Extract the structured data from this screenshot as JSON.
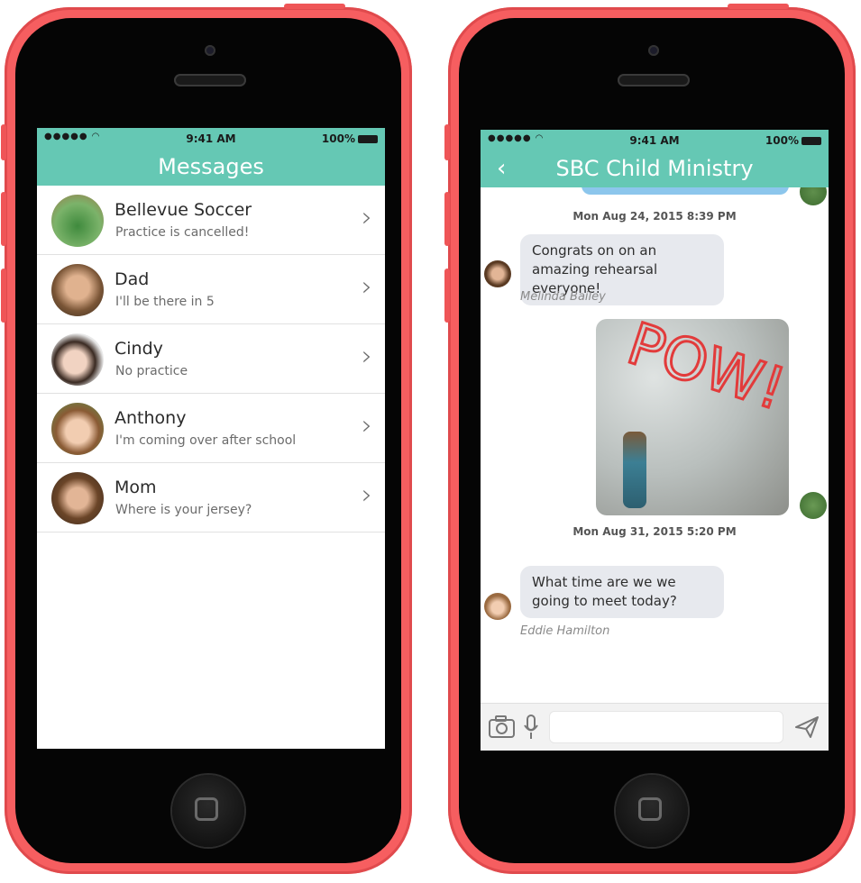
{
  "status_bar": {
    "signal": "●●●●● ",
    "time": "9:41 AM",
    "battery": "100%"
  },
  "left_screen": {
    "title": "Messages",
    "conversations": [
      {
        "name": "Bellevue Soccer",
        "preview": "Practice is cancelled!"
      },
      {
        "name": "Dad",
        "preview": "I'll be there in 5"
      },
      {
        "name": "Cindy",
        "preview": "No practice"
      },
      {
        "name": "Anthony",
        "preview": "I'm coming over after school"
      },
      {
        "name": "Mom",
        "preview": "Where is your jersey?"
      }
    ]
  },
  "right_screen": {
    "title": "SBC Child Ministry",
    "back_label": "‹",
    "timestamp_1": "Mon Aug 24, 2015 8:39 PM",
    "message_1": {
      "text": "Congrats on on an amazing rehearsal everyone!",
      "sender": "Melinda Bailey"
    },
    "image_text": "POW!",
    "timestamp_2": "Mon Aug 31, 2015 5:20 PM",
    "message_2": {
      "text": "What time are we we going to meet today?",
      "sender": "Eddie Hamilton"
    }
  },
  "colors": {
    "accent": "#65c8b4",
    "phone": "#f65e60",
    "bubble_out": "#8cc6ec",
    "bubble_in": "#e7e9ee"
  },
  "icons": [
    "wifi-icon",
    "battery-icon",
    "chevron-right-icon",
    "back-chevron-icon",
    "camera-icon",
    "microphone-icon",
    "send-icon"
  ]
}
